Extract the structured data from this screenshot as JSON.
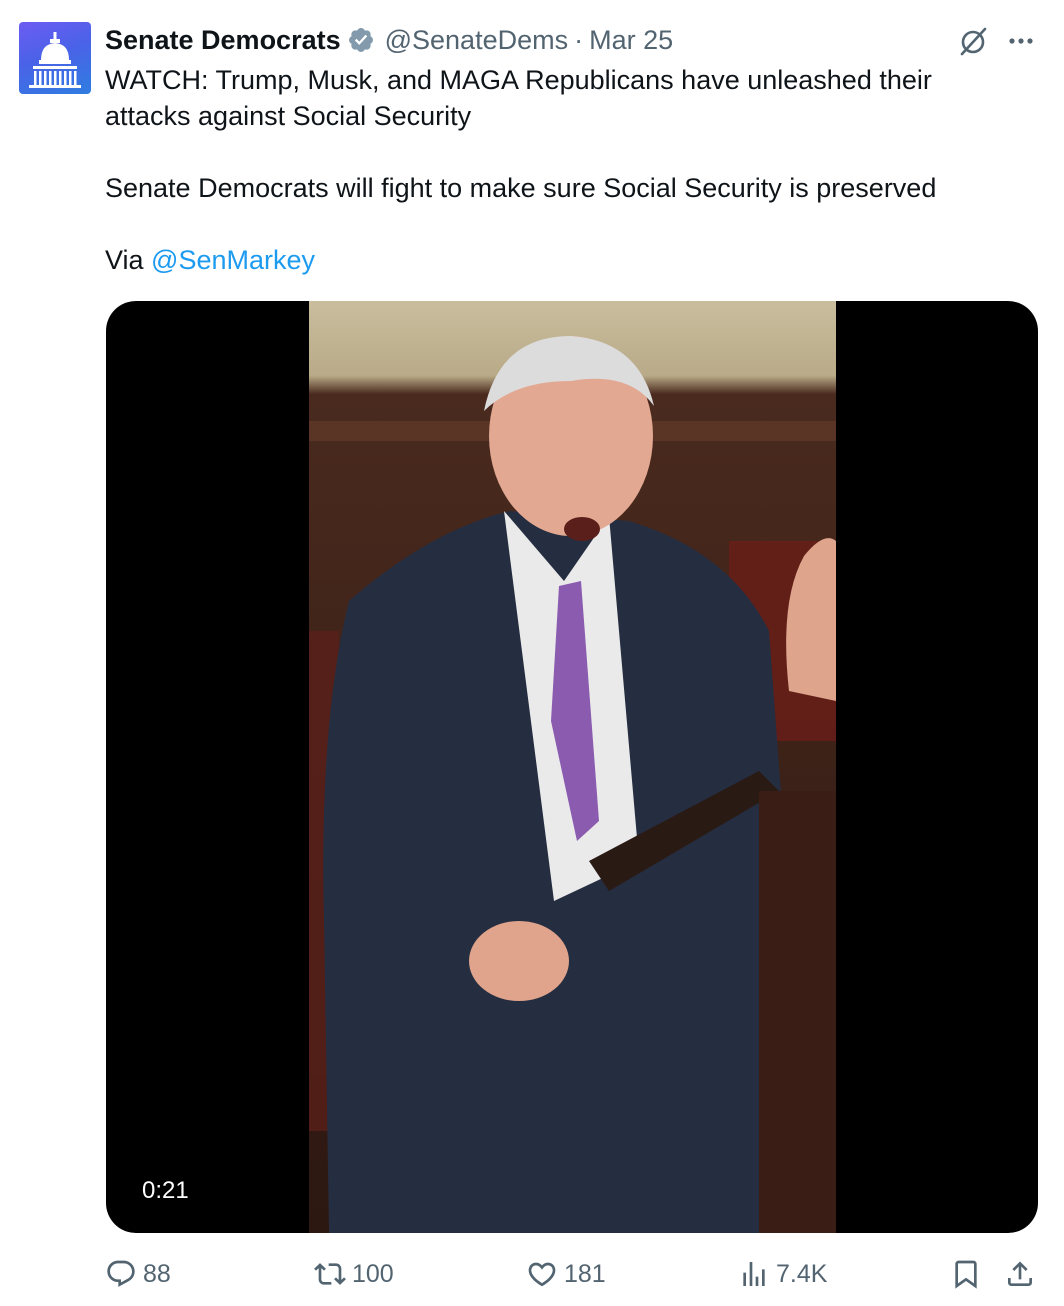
{
  "tweet": {
    "author_name": "Senate Democrats",
    "handle": "@SenateDems",
    "separator": "·",
    "date": "Mar 25",
    "text_line1": "WATCH: Trump, Musk, and MAGA Republicans have unleashed their attacks against Social Security",
    "text_line2": "Senate Democrats will fight to make sure Social Security is preserved",
    "via_label": "Via ",
    "mention": "@SenMarkey"
  },
  "media": {
    "duration": "0:21"
  },
  "actions": {
    "replies": "88",
    "reposts": "100",
    "likes": "181",
    "views": "7.4K"
  },
  "colors": {
    "accent": "#1d9bf0",
    "verified": "#829aab",
    "secondary_text": "#536471",
    "avatar_gradient": [
      "#6d5cf2",
      "#2f7de0"
    ]
  },
  "icons": [
    "capitol-logo",
    "verified-badge-icon",
    "grok-icon",
    "more-icon",
    "reply-icon",
    "repost-icon",
    "like-icon",
    "views-icon",
    "bookmark-icon",
    "share-icon"
  ]
}
